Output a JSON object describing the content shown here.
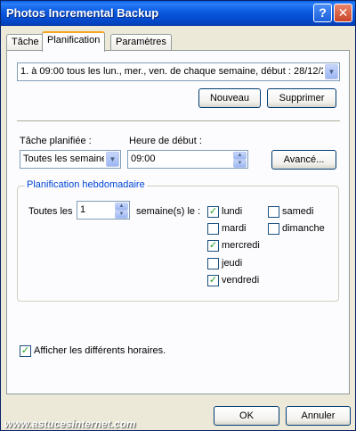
{
  "window": {
    "title": "Photos Incremental Backup",
    "help_glyph": "?",
    "close_glyph": "✕"
  },
  "tabs": [
    {
      "label": "Tâche"
    },
    {
      "label": "Planification"
    },
    {
      "label": "Paramètres"
    }
  ],
  "schedule": {
    "selected": "1. à 09:00 tous les lun., mer., ven. de chaque semaine, début : 28/12/2",
    "new_label": "Nouveau",
    "delete_label": "Supprimer"
  },
  "task": {
    "label": "Tâche planifiée :",
    "value": "Toutes les semaine",
    "start_label": "Heure de début :",
    "start_value": "09:00",
    "advanced_label": "Avancé..."
  },
  "weekly": {
    "title": "Planification hebdomadaire",
    "every_label": "Toutes les",
    "every_value": "1",
    "weeks_label": "semaine(s) le :",
    "days": [
      {
        "label": "lundi",
        "checked": true
      },
      {
        "label": "mardi",
        "checked": false
      },
      {
        "label": "mercredi",
        "checked": true
      },
      {
        "label": "jeudi",
        "checked": false
      },
      {
        "label": "vendredi",
        "checked": true
      },
      {
        "label": "samedi",
        "checked": false
      },
      {
        "label": "dimanche",
        "checked": false
      }
    ]
  },
  "show_multiple": {
    "label": "Afficher les différents horaires.",
    "checked": true
  },
  "footer": {
    "ok_label": "OK",
    "cancel_label": "Annuler"
  },
  "watermark": "www.astucesinternet.com",
  "colors": {
    "title_bar": "#0b5ae0",
    "group_title": "#0046d5",
    "check": "#21a121"
  }
}
